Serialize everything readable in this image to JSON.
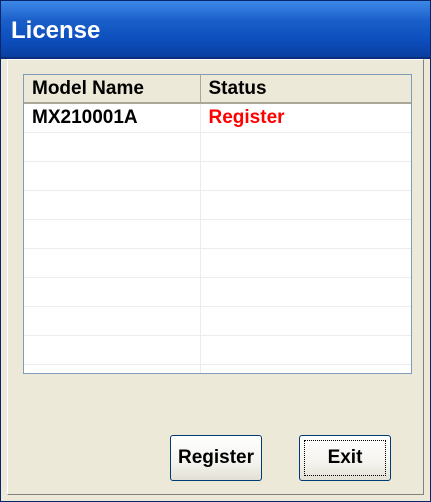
{
  "window": {
    "title": "License"
  },
  "table": {
    "columns": [
      "Model Name",
      "Status"
    ],
    "rows": [
      {
        "model": "MX210001A",
        "status": "Register"
      },
      {
        "model": "",
        "status": ""
      },
      {
        "model": "",
        "status": ""
      },
      {
        "model": "",
        "status": ""
      },
      {
        "model": "",
        "status": ""
      },
      {
        "model": "",
        "status": ""
      },
      {
        "model": "",
        "status": ""
      },
      {
        "model": "",
        "status": ""
      },
      {
        "model": "",
        "status": ""
      },
      {
        "model": "",
        "status": ""
      }
    ]
  },
  "buttons": {
    "register": "Register",
    "exit": "Exit"
  },
  "colors": {
    "titlebar": "#0c4ebd",
    "status_register": "#ff0000"
  }
}
